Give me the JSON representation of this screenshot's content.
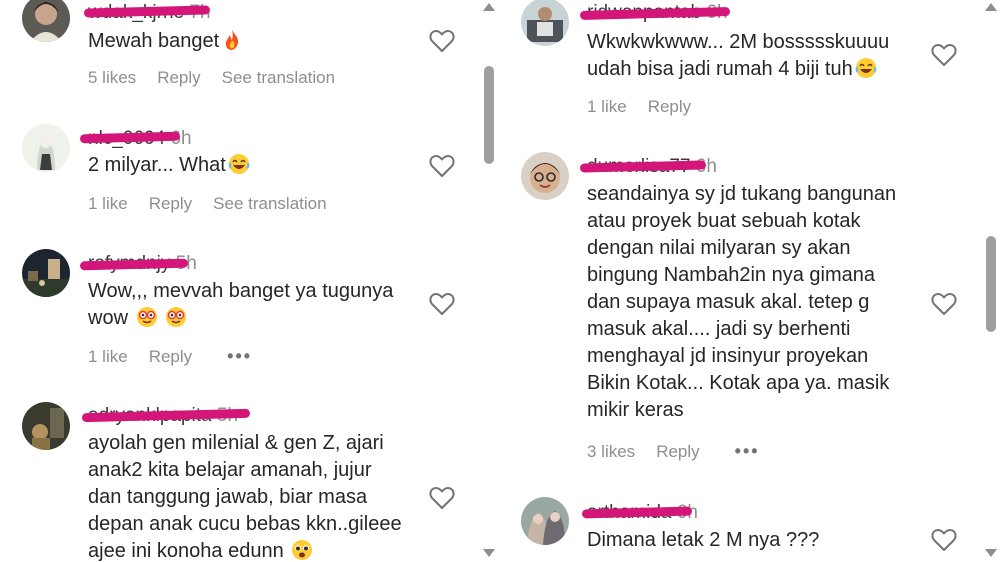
{
  "left": [
    {
      "username": "wdak_kjrne",
      "time": "7h",
      "text": "Mewah banget",
      "emoji": "fire",
      "likes": "5 likes",
      "reply": "Reply",
      "translation": "See translation"
    },
    {
      "username": "nlc_0604",
      "time": "6h",
      "text": "2 milyar... What",
      "emoji": "laughing",
      "likes": "1 like",
      "reply": "Reply",
      "translation": "See translation"
    },
    {
      "username": "rofymdnjy",
      "time": "5h",
      "text": "Wow,,, mevvah banget ya tugunya\nwow",
      "emoji2": "nerd",
      "likes": "1 like",
      "reply": "Reply",
      "more": "•••"
    },
    {
      "username": "adryanklpapita",
      "time": "5h",
      "text": "ayolah gen milenial & gen Z, ajari\nanak2 kita belajar amanah, jujur\ndan tanggung jawab, biar masa\ndepan anak cucu bebas kkn..gileee\najee ini konoha edunn",
      "emoji": "pleading"
    }
  ],
  "right": [
    {
      "username": "ridwanpantab",
      "time": "6h",
      "text": "Wkwkwkwww... 2M bossssskuuuu\nudah bisa jadi rumah 4 biji tuh",
      "emoji": "laughing",
      "likes": "1 like",
      "reply": "Reply"
    },
    {
      "username": "dumerlisa77",
      "time": "6h",
      "text": "seandainya sy jd tukang bangunan\natau proyek buat sebuah kotak\ndengan nilai milyaran sy akan\nbingung Nambah2in nya gimana\ndan supaya masuk akal. tetep g\nmasuk akal.... jadi sy berhenti\nmenghayal jd insinyur proyekan\nBikin Kotak... Kotak apa ya. masik\nmikir keras",
      "likes": "3 likes",
      "reply": "Reply",
      "more": "•••"
    },
    {
      "username": "arthamida",
      "time": "6h",
      "text": "Dimana letak 2 M nya ???"
    }
  ],
  "colors": {
    "redaction": "#d4157a",
    "meta_text": "#8e8e8e",
    "body_text": "#262626",
    "scrollbar": "#9e9e9e"
  },
  "icons": {
    "heart": "heart-outline-icon",
    "scroll_up": "scroll-up-arrow-icon",
    "scroll_down": "scroll-down-arrow-icon"
  }
}
